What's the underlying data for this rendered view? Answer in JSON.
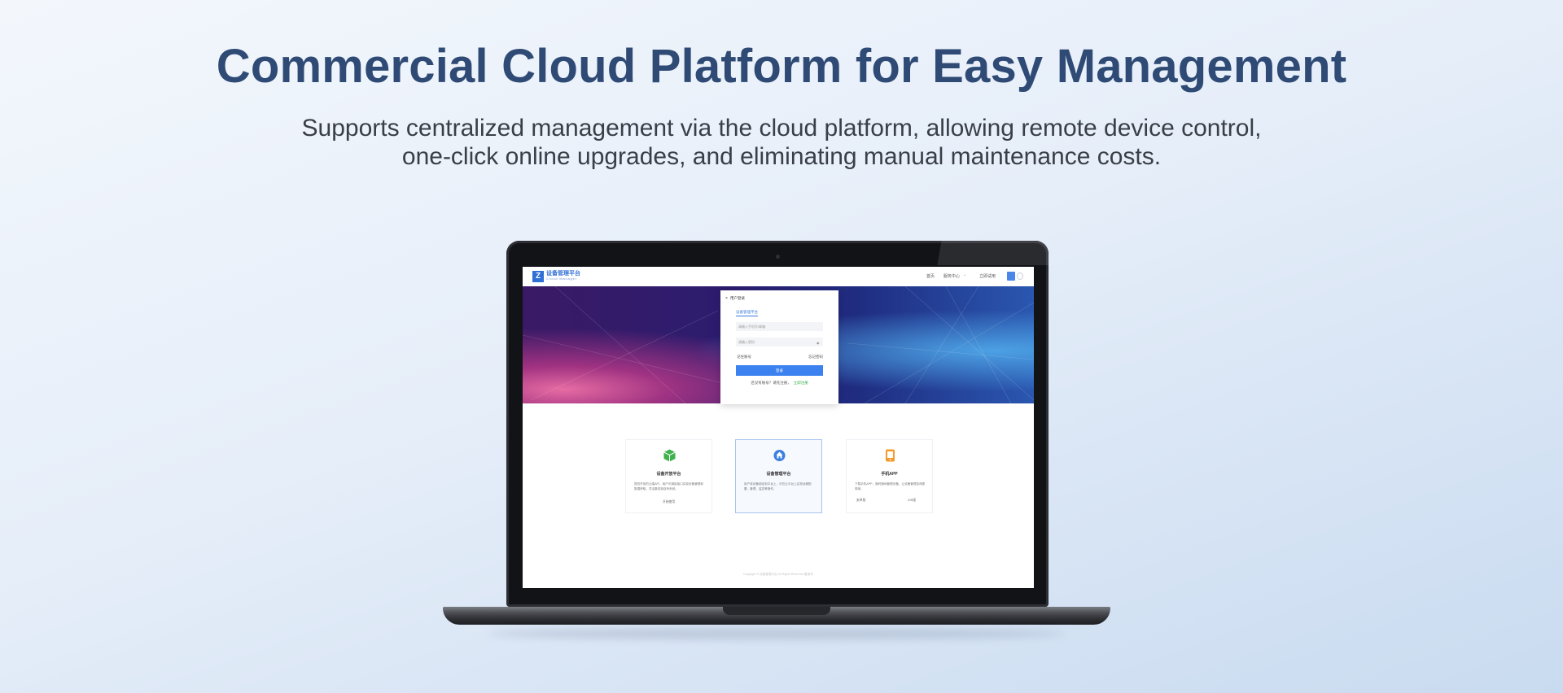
{
  "hero": {
    "title": "Commercial Cloud Platform for Easy Management",
    "subtitle_line1": "Supports centralized management via the cloud platform, allowing remote device control,",
    "subtitle_line2": "one-click online upgrades, and eliminating manual maintenance costs."
  },
  "colors": {
    "headline": "#2f4b75",
    "accent": "#3b82f0",
    "link_green": "#3ab04a"
  },
  "app": {
    "logo_text": "设备管理平台",
    "logo_sub": "Cloud Manager",
    "nav": {
      "item1": "首页",
      "item2": "服务中心",
      "item3": "立即试用"
    },
    "login": {
      "title": "用户登录",
      "tab": "设备管理平台",
      "account_placeholder": "请输入手机号/邮箱",
      "password_placeholder": "请输入密码",
      "remember": "记住账号",
      "forgot": "忘记密码",
      "submit": "登录",
      "register_prompt": "还没有账号？请先注册，",
      "register_link": "立即注册"
    },
    "cards": [
      {
        "title": "设备开放平台",
        "desc": "提供开放的云端API，用户可调用接口实现设备管理和数据获取，灵活集成到自有系统。",
        "link": "开始使用",
        "icon": "cube-icon"
      },
      {
        "title": "设备管理平台",
        "desc": "用户将设备绑定到平台上，可在云平台上实现远程配置、管理、监控等操作。",
        "icon": "cloud-home-icon"
      },
      {
        "title": "手机APP",
        "desc": "下载手机APP，随时随地管理设备，让设备管理变得更简单。",
        "opt1": "安卓版",
        "opt2": "iOS版",
        "icon": "app-icon"
      }
    ],
    "footer": "Copyright © 设备管理平台 All Rights Reserved 备案号"
  }
}
